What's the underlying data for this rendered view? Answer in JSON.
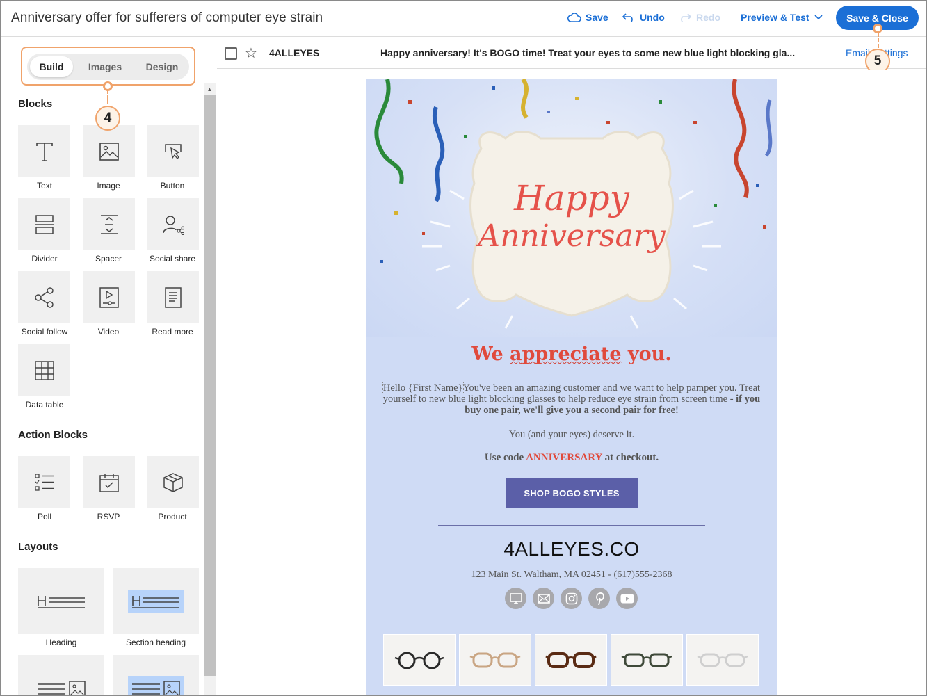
{
  "header": {
    "title": "Anniversary offer for sufferers of computer eye strain",
    "save_label": "Save",
    "undo_label": "Undo",
    "redo_label": "Redo",
    "preview_label": "Preview & Test",
    "save_close_label": "Save & Close"
  },
  "sidebar": {
    "tabs": [
      "Build",
      "Images",
      "Design"
    ],
    "active_tab": "Build",
    "blocks_title": "Blocks",
    "blocks": [
      "Text",
      "Image",
      "Button",
      "Divider",
      "Spacer",
      "Social share",
      "Social follow",
      "Video",
      "Read more",
      "Data table"
    ],
    "action_blocks_title": "Action Blocks",
    "action_blocks": [
      "Poll",
      "RSVP",
      "Product"
    ],
    "layouts_title": "Layouts",
    "layouts": [
      "Heading",
      "Section heading"
    ]
  },
  "callouts": {
    "tabs": "4",
    "save_close": "5"
  },
  "mailrow": {
    "sender": "4ALLEYES",
    "subject": "Happy anniversary! It's BOGO time! Treat your eyes to some new blue light blocking gla...",
    "email_settings": "Email Settings"
  },
  "email": {
    "hero_line1": "Happy",
    "hero_line2": "Anniversary",
    "headline_pre": "We ",
    "headline_sq": "appreciate",
    "headline_post": " you.",
    "hello": "Hello {First Name}",
    "body_1": "You've been an amazing customer and we want to help pamper you. Treat yourself to new blue light blocking glasses to help reduce eye strain from screen time - ",
    "body_bold": "if you buy one pair, we'll give you a second pair for free!",
    "deserve": "You (and your eyes) deserve it.",
    "code_pre": "Use code ",
    "code": "ANNIVERSARY",
    "code_post": " at checkout.",
    "button": "SHOP BOGO STYLES",
    "brand": "4ALLEYES.CO",
    "address": "123 Main St. Waltham, MA 02451 - (617)555-2368",
    "social_icons": [
      "website-icon",
      "email-icon",
      "instagram-icon",
      "pinterest-icon",
      "youtube-icon"
    ],
    "product_count": 5
  },
  "colors": {
    "accent": "#1b6fd6",
    "callout": "#f0a36b",
    "email_bg": "#cfdbf5",
    "headline": "#e04a3c",
    "button": "#5b5fa8"
  }
}
